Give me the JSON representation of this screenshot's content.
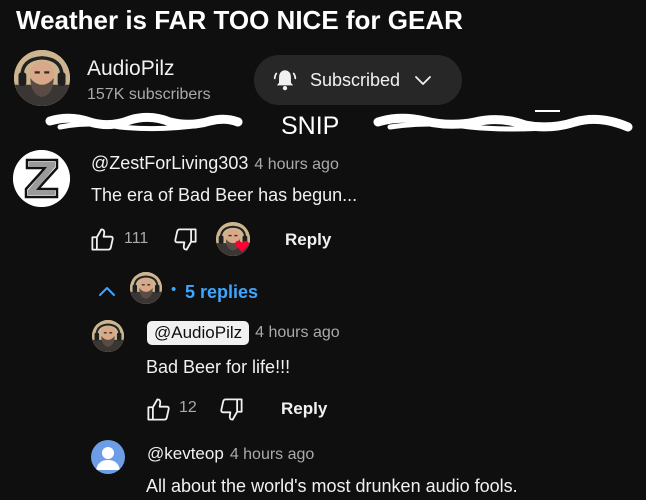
{
  "video": {
    "title": "Weather is FAR TOO NICE for GEAR"
  },
  "channel": {
    "name": "AudioPilz",
    "subscribers": "157K subscribers",
    "subscribe_button_label": "Subscribed"
  },
  "overlay": {
    "snip_label": "SNIP"
  },
  "comment": {
    "handle": "@ZestForLiving303",
    "time": "4 hours ago",
    "text": "The era of Bad Beer has begun...",
    "likes": "111",
    "reply_label": "Reply",
    "replies_label": "5 replies"
  },
  "replies": [
    {
      "handle": "@AudioPilz",
      "time": "4 hours ago",
      "text": "Bad Beer for life!!!",
      "likes": "12",
      "reply_label": "Reply"
    },
    {
      "handle": "@kevteop",
      "time": "4 hours ago",
      "text": "All about the world's most drunken audio fools."
    }
  ],
  "colors": {
    "background": "#0f0f0f",
    "link_blue": "#3ea6ff",
    "heart_red": "#ff0033",
    "chip_bg": "#272727"
  }
}
